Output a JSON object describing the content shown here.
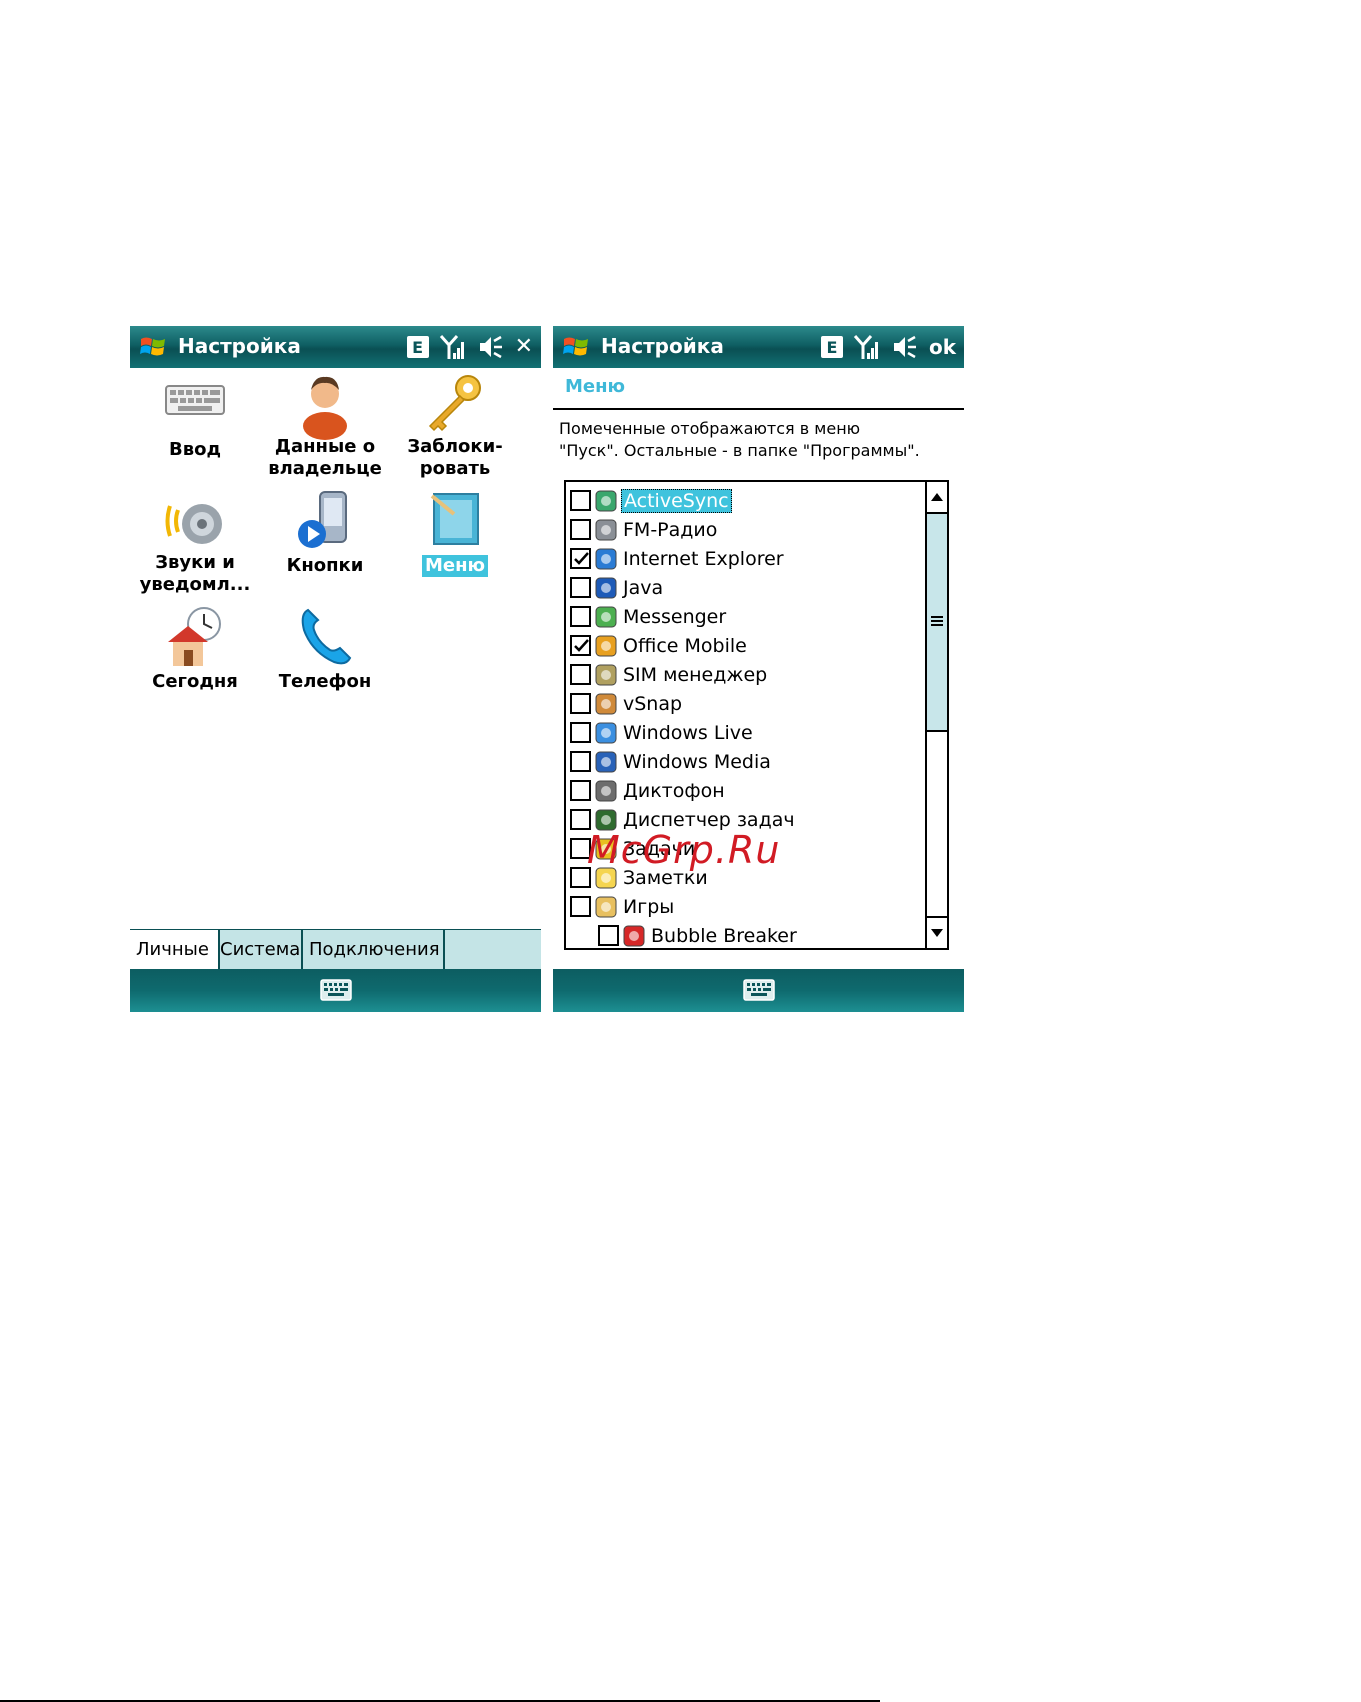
{
  "left_screen": {
    "title": "Настройка",
    "status_e": "E",
    "close_label": "✕",
    "items": [
      {
        "label_line1": "Ввод",
        "label_line2": "",
        "icon": "keyboard-icon"
      },
      {
        "label_line1": "Данные о",
        "label_line2": "владельце",
        "icon": "owner-info-icon"
      },
      {
        "label_line1": "Заблоки-",
        "label_line2": "ровать",
        "icon": "key-icon"
      },
      {
        "label_line1": "Звуки и",
        "label_line2": "уведомл...",
        "icon": "sound-icon"
      },
      {
        "label_line1": "Кнопки",
        "label_line2": "",
        "icon": "buttons-icon"
      },
      {
        "label_line1": "Меню",
        "label_line2": "",
        "icon": "menu-icon",
        "selected": true
      },
      {
        "label_line1": "Сегодня",
        "label_line2": "",
        "icon": "today-icon"
      },
      {
        "label_line1": "Телефон",
        "label_line2": "",
        "icon": "phone-icon"
      }
    ],
    "tabs": [
      {
        "label": "Личные",
        "active": true
      },
      {
        "label": "Система",
        "active": false
      },
      {
        "label": "Подключения",
        "active": false
      }
    ]
  },
  "right_screen": {
    "title": "Настройка",
    "status_e": "E",
    "ok_label": "ok",
    "heading": "Меню",
    "description_line1": "Помеченные отображаются в меню",
    "description_line2": "\"Пуск\". Остальные - в папке \"Программы\".",
    "items": [
      {
        "label": "ActiveSync",
        "checked": false,
        "selected": true,
        "indent": 0,
        "icon": "activesync-icon"
      },
      {
        "label": "FM-Радио",
        "checked": false,
        "indent": 0,
        "icon": "radio-icon"
      },
      {
        "label": "Internet Explorer",
        "checked": true,
        "indent": 0,
        "icon": "internet-explorer-icon"
      },
      {
        "label": "Java",
        "checked": false,
        "indent": 0,
        "icon": "java-icon"
      },
      {
        "label": "Messenger",
        "checked": false,
        "indent": 0,
        "icon": "messenger-icon"
      },
      {
        "label": "Office Mobile",
        "checked": true,
        "indent": 0,
        "icon": "office-mobile-icon"
      },
      {
        "label": "SIM менеджер",
        "checked": false,
        "indent": 0,
        "icon": "sim-manager-icon"
      },
      {
        "label": "vSnap",
        "checked": false,
        "indent": 0,
        "icon": "vsnap-icon"
      },
      {
        "label": "Windows Live",
        "checked": false,
        "indent": 0,
        "icon": "windows-live-icon"
      },
      {
        "label": "Windows Media",
        "checked": false,
        "indent": 0,
        "icon": "windows-media-icon"
      },
      {
        "label": "Диктофон",
        "checked": false,
        "indent": 0,
        "icon": "voice-recorder-icon"
      },
      {
        "label": "Диспетчер задач",
        "checked": false,
        "indent": 0,
        "icon": "task-manager-icon"
      },
      {
        "label": "Задачи",
        "checked": false,
        "indent": 0,
        "icon": "tasks-icon"
      },
      {
        "label": "Заметки",
        "checked": false,
        "indent": 0,
        "icon": "notes-icon"
      },
      {
        "label": "Игры",
        "checked": false,
        "indent": 0,
        "icon": "games-folder-icon"
      },
      {
        "label": "Bubble Breaker",
        "checked": false,
        "indent": 1,
        "icon": "bubble-breaker-icon"
      }
    ]
  },
  "watermark": "McGrp.Ru",
  "colors": {
    "titlebar": "#0f5f63",
    "selection": "#3fc3dd",
    "heading": "#3fb8d8",
    "tabs_bg": "#c4e4e6",
    "watermark": "#d11b24"
  }
}
